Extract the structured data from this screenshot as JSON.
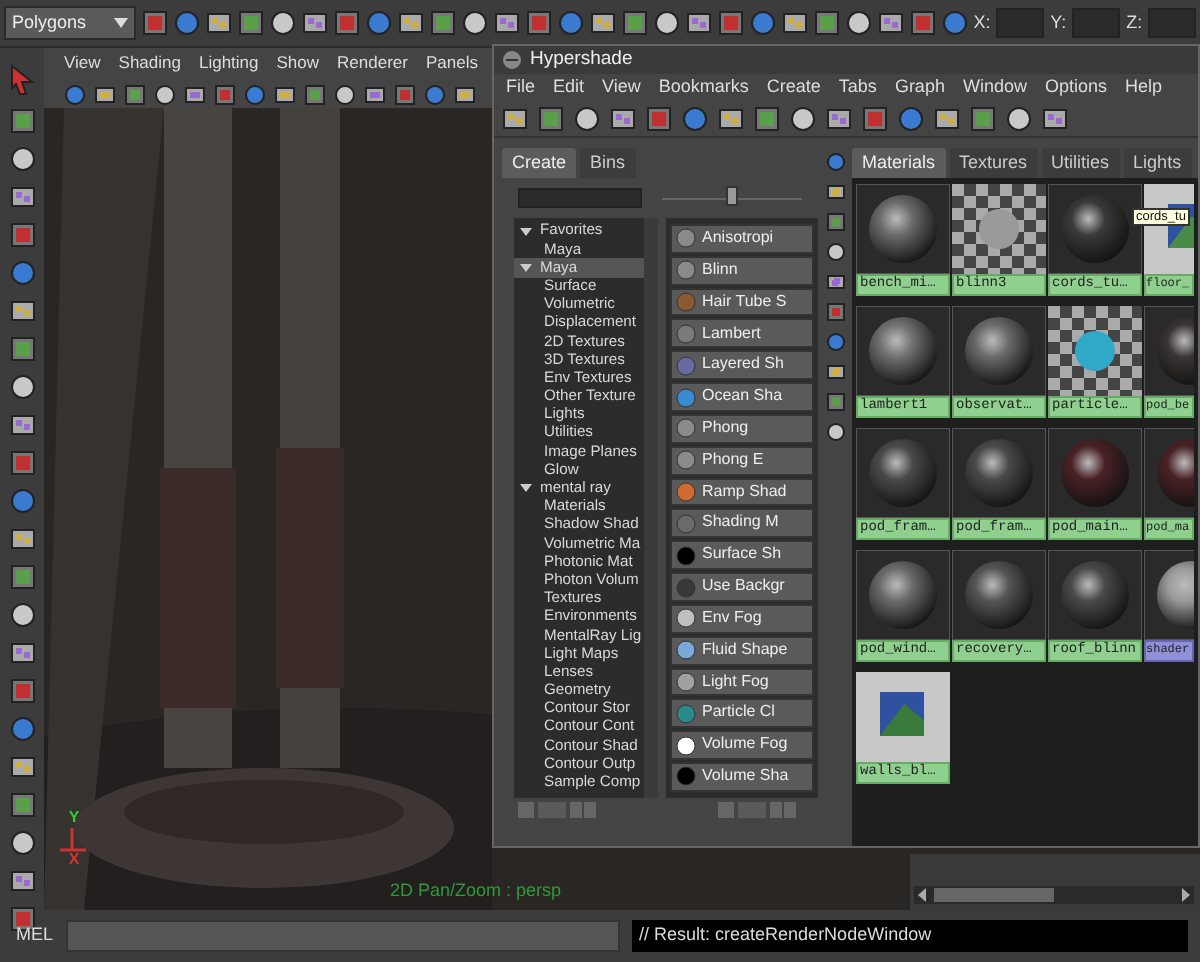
{
  "main_toolbar": {
    "mode_menu": "Polygons",
    "coord_labels": [
      "X:",
      "Y:",
      "Z:"
    ]
  },
  "viewport": {
    "menu": [
      "View",
      "Shading",
      "Lighting",
      "Show",
      "Renderer",
      "Panels"
    ],
    "hud_text": "2D Pan/Zoom : persp",
    "axis_labels": [
      "Y",
      "X"
    ]
  },
  "hypershade": {
    "title": "Hypershade",
    "menu": [
      "File",
      "Edit",
      "View",
      "Bookmarks",
      "Create",
      "Tabs",
      "Graph",
      "Window",
      "Options",
      "Help"
    ],
    "size_slider": {
      "level": 0.5
    },
    "left_tabs": [
      {
        "label": "Create",
        "selected": true
      },
      {
        "label": "Bins",
        "selected": false
      }
    ],
    "tree": [
      {
        "label": "Favorites",
        "expanded": true,
        "selected": false,
        "children": [
          {
            "label": "Maya",
            "selected": false
          }
        ]
      },
      {
        "label": "Maya",
        "expanded": true,
        "selected": true,
        "children": [
          {
            "label": "Surface",
            "selected": false
          },
          {
            "label": "Volumetric",
            "selected": false
          },
          {
            "label": "Displacement",
            "selected": false
          },
          {
            "label": "2D Textures",
            "selected": false
          },
          {
            "label": "3D Textures",
            "selected": false
          },
          {
            "label": "Env Textures",
            "selected": false
          },
          {
            "label": "Other Texture",
            "selected": false
          },
          {
            "label": "Lights",
            "selected": false
          },
          {
            "label": "Utilities",
            "selected": false
          },
          {
            "label": "Image Planes",
            "selected": false
          },
          {
            "label": "Glow",
            "selected": false
          }
        ]
      },
      {
        "label": "mental ray",
        "expanded": true,
        "selected": false,
        "children": [
          {
            "label": "Materials",
            "selected": false
          },
          {
            "label": "Shadow Shad",
            "selected": false
          },
          {
            "label": "Volumetric Ma",
            "selected": false
          },
          {
            "label": "Photonic Mat",
            "selected": false
          },
          {
            "label": "Photon Volum",
            "selected": false
          },
          {
            "label": "Textures",
            "selected": false
          },
          {
            "label": "Environments",
            "selected": false
          },
          {
            "label": "MentalRay Lig",
            "selected": false
          },
          {
            "label": "Light Maps",
            "selected": false
          },
          {
            "label": "Lenses",
            "selected": false
          },
          {
            "label": "Geometry",
            "selected": false
          },
          {
            "label": "Contour Stor",
            "selected": false
          },
          {
            "label": "Contour Cont",
            "selected": false
          },
          {
            "label": "Contour Shad",
            "selected": false
          },
          {
            "label": "Contour Outp",
            "selected": false
          },
          {
            "label": "Sample Comp",
            "selected": false
          }
        ]
      }
    ],
    "render_nodes": [
      {
        "label": "Anisotropi",
        "color": "#8a8a8a"
      },
      {
        "label": "Blinn",
        "color": "#8a8a8a"
      },
      {
        "label": "Hair Tube S",
        "color": "#8a5a30"
      },
      {
        "label": "Lambert",
        "color": "#7a7a7a"
      },
      {
        "label": "Layered Sh",
        "color": "#6a6aa0"
      },
      {
        "label": "Ocean Sha",
        "color": "#3a8ad0"
      },
      {
        "label": "Phong",
        "color": "#8a8a8a"
      },
      {
        "label": "Phong E",
        "color": "#8a8a8a"
      },
      {
        "label": "Ramp Shad",
        "color": "#d06a30"
      },
      {
        "label": "Shading M",
        "color": "#6a6a6a"
      },
      {
        "label": "Surface Sh",
        "color": "#000000"
      },
      {
        "label": "Use Backgr",
        "color": "#383838"
      },
      {
        "label": "Env Fog",
        "color": "#c0c0c0"
      },
      {
        "label": "Fluid Shape",
        "color": "#7aa8d8"
      },
      {
        "label": "Light Fog",
        "color": "#a0a0a0"
      },
      {
        "label": "Particle Cl",
        "color": "#2a8a8a"
      },
      {
        "label": "Volume Fog",
        "color": "#ffffff"
      },
      {
        "label": "Volume Sha",
        "color": "#000000"
      }
    ],
    "right_tabs": [
      {
        "label": "Materials",
        "selected": true
      },
      {
        "label": "Textures",
        "selected": false
      },
      {
        "label": "Utilities",
        "selected": false
      },
      {
        "label": "Lights",
        "selected": false
      }
    ],
    "materials": [
      {
        "label": "bench_mi…",
        "kind": "sphere",
        "color": "#6a6a6a",
        "selected": false
      },
      {
        "label": "blinn3",
        "kind": "checker",
        "color": "#9a9a9a",
        "selected": false
      },
      {
        "label": "cords_tu…",
        "kind": "sphere",
        "color": "#3a3a3a",
        "selected": false
      },
      {
        "label": "floor_",
        "kind": "texture",
        "color": "#4a8a4a",
        "selected": false
      },
      {
        "label": "lambert1",
        "kind": "sphere",
        "color": "#707070",
        "selected": false
      },
      {
        "label": "observat…",
        "kind": "sphere",
        "color": "#6a6a6a",
        "selected": false
      },
      {
        "label": "particle…",
        "kind": "checker",
        "color": "#30a8c8",
        "selected": false
      },
      {
        "label": "pod_be",
        "kind": "sphere",
        "color": "#3a3434",
        "selected": false
      },
      {
        "label": "pod_fram…",
        "kind": "sphere",
        "color": "#4a4a4a",
        "selected": false
      },
      {
        "label": "pod_fram…",
        "kind": "sphere",
        "color": "#4a4a4a",
        "selected": false
      },
      {
        "label": "pod_main…",
        "kind": "sphere",
        "color": "#4a2226",
        "selected": false
      },
      {
        "label": "pod_ma",
        "kind": "sphere",
        "color": "#4a2226",
        "selected": false
      },
      {
        "label": "pod_wind…",
        "kind": "sphere",
        "color": "#6a6a6a",
        "selected": false
      },
      {
        "label": "recovery…",
        "kind": "sphere",
        "color": "#555555",
        "selected": false
      },
      {
        "label": "roof_blinn",
        "kind": "sphere",
        "color": "#4a4a4a",
        "selected": false
      },
      {
        "label": "shader",
        "kind": "sphere",
        "color": "#9a9a9a",
        "selected": true
      },
      {
        "label": "walls_bl…",
        "kind": "texture",
        "color": "#3a7a3a",
        "selected": false
      }
    ],
    "tooltip": "cords_tu"
  },
  "command_line": {
    "label": "MEL",
    "result": "// Result: createRenderNodeWindow"
  }
}
